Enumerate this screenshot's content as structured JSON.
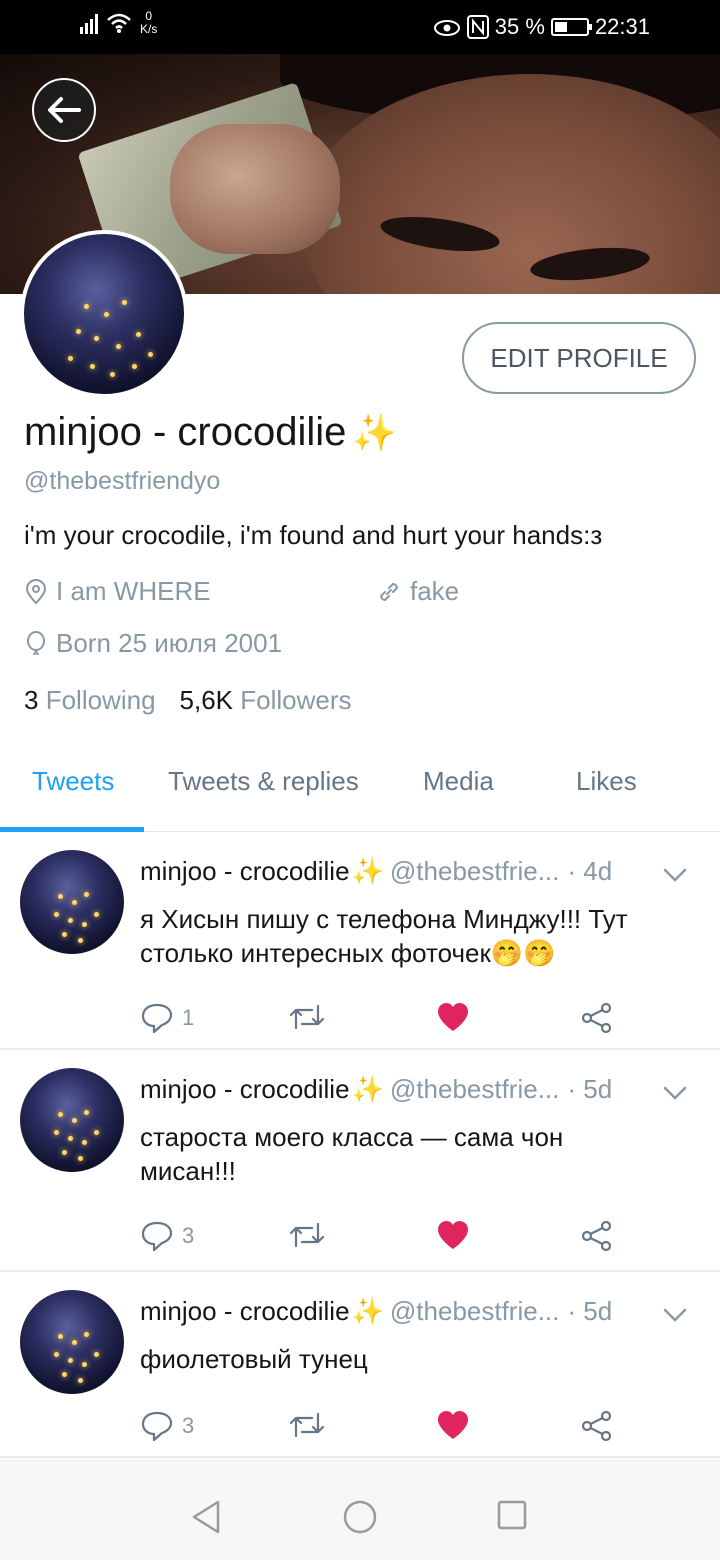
{
  "status_bar": {
    "net_speed_value": "0",
    "net_speed_unit": "K/s",
    "battery": "35 %",
    "time": "22:31"
  },
  "profile": {
    "edit_label": "EDIT PROFILE",
    "name": "minjoo - crocodilie",
    "name_emoji": "✨",
    "handle": "@thebestfriendyo",
    "bio": "i'm your crocodile, i'm found and hurt your hands:з",
    "location": "I am WHERE",
    "website": "fake",
    "born": "Born 25 июля 2001",
    "following_count": "3",
    "following_label": "Following",
    "followers_count": "5,6K",
    "followers_label": "Followers"
  },
  "tabs": [
    {
      "label": "Tweets",
      "active": true
    },
    {
      "label": "Tweets & replies",
      "active": false
    },
    {
      "label": "Media",
      "active": false
    },
    {
      "label": "Likes",
      "active": false
    }
  ],
  "tweets": [
    {
      "name": "minjoo - crocodilie",
      "emoji": "✨",
      "handle": "@thebestfrie...",
      "time": "· 4d",
      "line1": "я Хисын пишу с телефона Минджу!!! Тут",
      "line2": "столько интересных фоточек🤭🤭",
      "replies": "1"
    },
    {
      "name": "minjoo - crocodilie",
      "emoji": "✨",
      "handle": "@thebestfrie...",
      "time": "· 5d",
      "line1": "староста моего класса — сама чон",
      "line2": "мисан!!!",
      "replies": "3"
    },
    {
      "name": "minjoo - crocodilie",
      "emoji": "✨",
      "handle": "@thebestfrie...",
      "time": "· 5d",
      "line1": "фиолетовый тунец",
      "line2": "",
      "replies": "3"
    }
  ],
  "colors": {
    "accent": "#1da1f2",
    "like": "#e0245e",
    "muted": "#8899a6"
  }
}
